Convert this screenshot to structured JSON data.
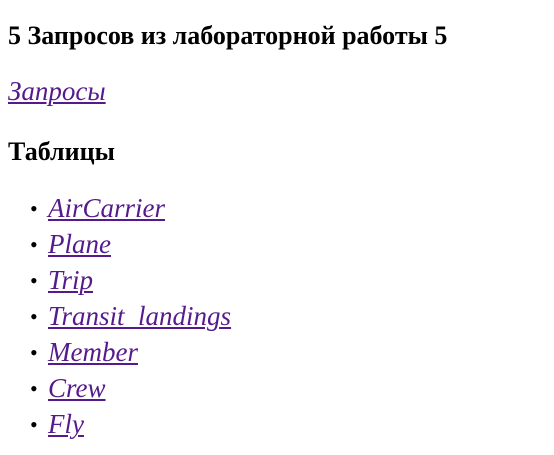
{
  "page": {
    "title": "5 Запросов из лабораторной работы 5",
    "queries_link": "Запросы",
    "tables_heading": "Таблицы"
  },
  "tables": [
    {
      "label": "AirCarrier"
    },
    {
      "label": "Plane"
    },
    {
      "label": "Trip"
    },
    {
      "label": "Transit_landings"
    },
    {
      "label": "Member"
    },
    {
      "label": "Crew"
    },
    {
      "label": "Fly"
    }
  ],
  "colors": {
    "link": "#551a8b",
    "text": "#000000"
  }
}
